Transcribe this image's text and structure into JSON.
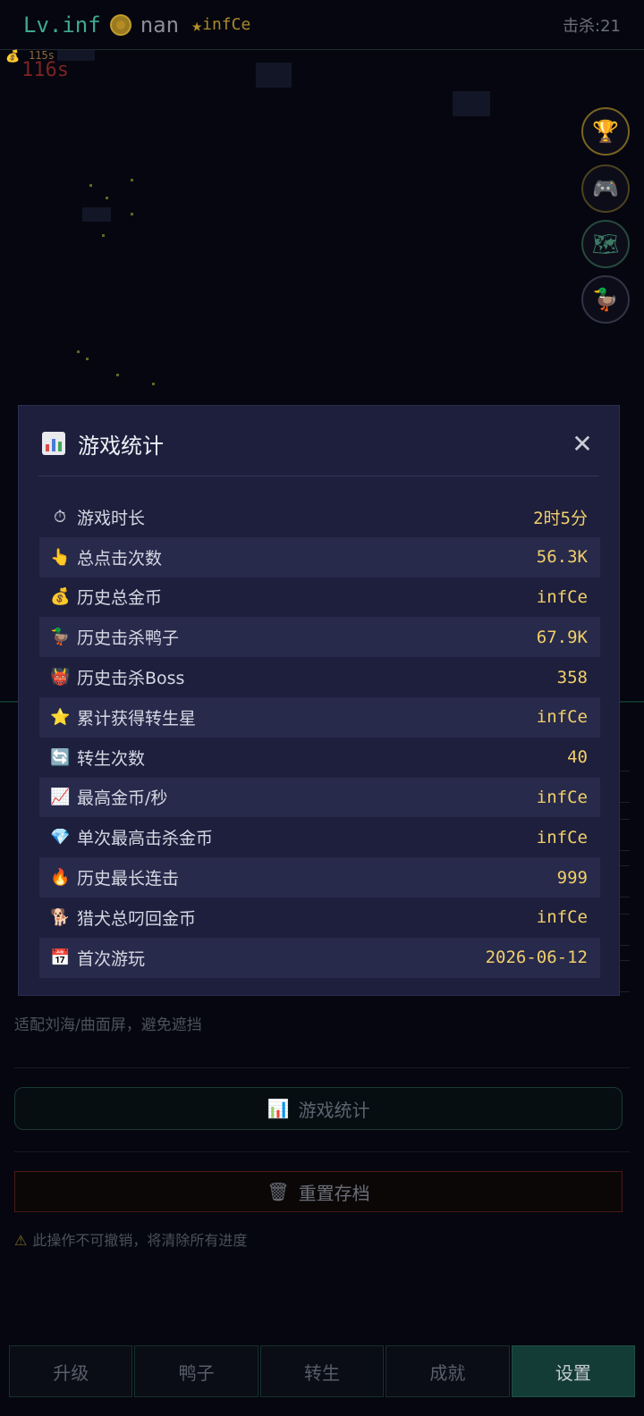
{
  "hud": {
    "level": "Lv.inf",
    "gold": "nan",
    "stars": "infCe",
    "kills": "击杀:21"
  },
  "gps": {
    "small": "115s",
    "big": "116s"
  },
  "side_buttons": [
    "trophy-icon",
    "gamepad-icon",
    "map-icon",
    "duck-icon"
  ],
  "background": {
    "hint": "适配刘海/曲面屏，避免遮挡",
    "stats_button": "游戏统计",
    "reset_button": "重置存档",
    "warning": "此操作不可撤销，将清除所有进度"
  },
  "tabs": [
    "升级",
    "鸭子",
    "转生",
    "成就",
    "设置"
  ],
  "active_tab": 4,
  "modal": {
    "title": "游戏统计",
    "stats": [
      {
        "icon": "⏱",
        "icon_name": "stopwatch-icon",
        "label": "游戏时长",
        "value": "2时5分"
      },
      {
        "icon": "👆",
        "icon_name": "pointer-icon",
        "label": "总点击次数",
        "value": "56.3K"
      },
      {
        "icon": "💰",
        "icon_name": "money-bag-icon",
        "label": "历史总金币",
        "value": "infCe"
      },
      {
        "icon": "🦆",
        "icon_name": "duck-icon",
        "label": "历史击杀鸭子",
        "value": "67.9K"
      },
      {
        "icon": "👹",
        "icon_name": "ogre-icon",
        "label": "历史击杀Boss",
        "value": "358"
      },
      {
        "icon": "⭐",
        "icon_name": "star-icon",
        "label": "累计获得转生星",
        "value": "infCe"
      },
      {
        "icon": "🔄",
        "icon_name": "refresh-icon",
        "label": "转生次数",
        "value": "40"
      },
      {
        "icon": "📈",
        "icon_name": "chart-up-icon",
        "label": "最高金币/秒",
        "value": "infCe"
      },
      {
        "icon": "💎",
        "icon_name": "gem-icon",
        "label": "单次最高击杀金币",
        "value": "infCe"
      },
      {
        "icon": "🔥",
        "icon_name": "fire-icon",
        "label": "历史最长连击",
        "value": "999"
      },
      {
        "icon": "🐕",
        "icon_name": "dog-icon",
        "label": "猎犬总叼回金币",
        "value": "infCe"
      },
      {
        "icon": "📅",
        "icon_name": "calendar-icon",
        "label": "首次游玩",
        "value": "2026-06-12"
      }
    ]
  },
  "colors": {
    "background": "#05060f",
    "modal": "#1e1f3d",
    "value_gold": "#f1cf6a",
    "accent_teal": "#3fa894",
    "active_tab": "#143c36"
  }
}
